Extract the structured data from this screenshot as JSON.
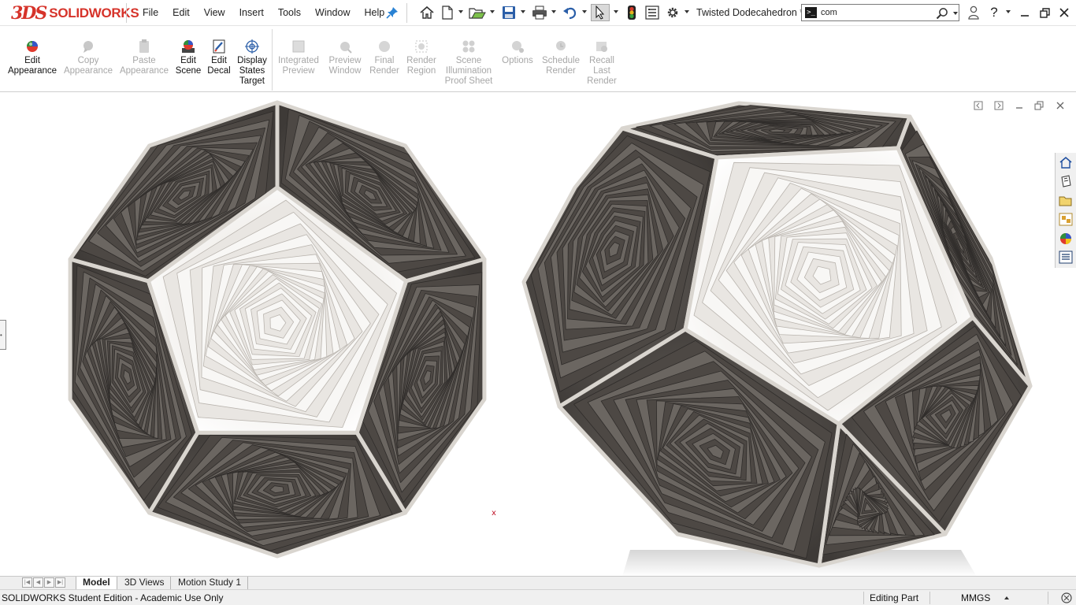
{
  "app": {
    "brand_prefix": "3DS",
    "brand_name": "SOLIDWORKS",
    "document_title": "Twisted Dodecahedron *"
  },
  "menu": [
    "File",
    "Edit",
    "View",
    "Insert",
    "Tools",
    "Window",
    "Help"
  ],
  "quick_access_icons": [
    "home-icon",
    "new-document-icon",
    "open-icon",
    "save-icon",
    "print-icon",
    "undo-icon",
    "select-icon",
    "rebuild-icon",
    "file-properties-icon",
    "options-icon"
  ],
  "search": {
    "value": "com"
  },
  "command_manager": {
    "tools": [
      {
        "l1": "Edit",
        "l2": "Appearance",
        "l3": "",
        "enabled": true
      },
      {
        "l1": "Copy",
        "l2": "Appearance",
        "l3": "",
        "enabled": false
      },
      {
        "l1": "Paste",
        "l2": "Appearance",
        "l3": "",
        "enabled": false
      },
      {
        "l1": "Edit",
        "l2": "Scene",
        "l3": "",
        "enabled": true
      },
      {
        "l1": "Edit",
        "l2": "Decal",
        "l3": "",
        "enabled": true
      },
      {
        "l1": "Display",
        "l2": "States",
        "l3": "Target",
        "enabled": true
      },
      {
        "l1": "Integrated",
        "l2": "Preview",
        "l3": "",
        "enabled": false
      },
      {
        "l1": "Preview",
        "l2": "Window",
        "l3": "",
        "enabled": false
      },
      {
        "l1": "Final",
        "l2": "Render",
        "l3": "",
        "enabled": false
      },
      {
        "l1": "Render",
        "l2": "Region",
        "l3": "",
        "enabled": false
      },
      {
        "l1": "Scene",
        "l2": "Illumination",
        "l3": "Proof Sheet",
        "enabled": false
      },
      {
        "l1": "Options",
        "l2": "",
        "l3": "",
        "enabled": false
      },
      {
        "l1": "Schedule",
        "l2": "Render",
        "l3": "",
        "enabled": false
      },
      {
        "l1": "Recall",
        "l2": "Last",
        "l3": "Render",
        "enabled": false
      }
    ]
  },
  "viewport": {
    "origin_marker": "x",
    "task_pane_icons": [
      "solidworks-resources-icon",
      "design-library-icon",
      "file-explorer-icon",
      "view-palette-icon",
      "appearances-icon",
      "custom-properties-icon"
    ]
  },
  "tabs": [
    "Model",
    "3D Views",
    "Motion Study 1"
  ],
  "active_tab": "Model",
  "status": {
    "left": "SOLIDWORKS Student Edition - Academic Use Only",
    "editing": "Editing Part",
    "units": "MMGS"
  },
  "colors": {
    "brand_red": "#d6332a",
    "model_dark": "#5b5652",
    "model_light": "#f2f0ec",
    "frame": "#d9d5cf"
  }
}
